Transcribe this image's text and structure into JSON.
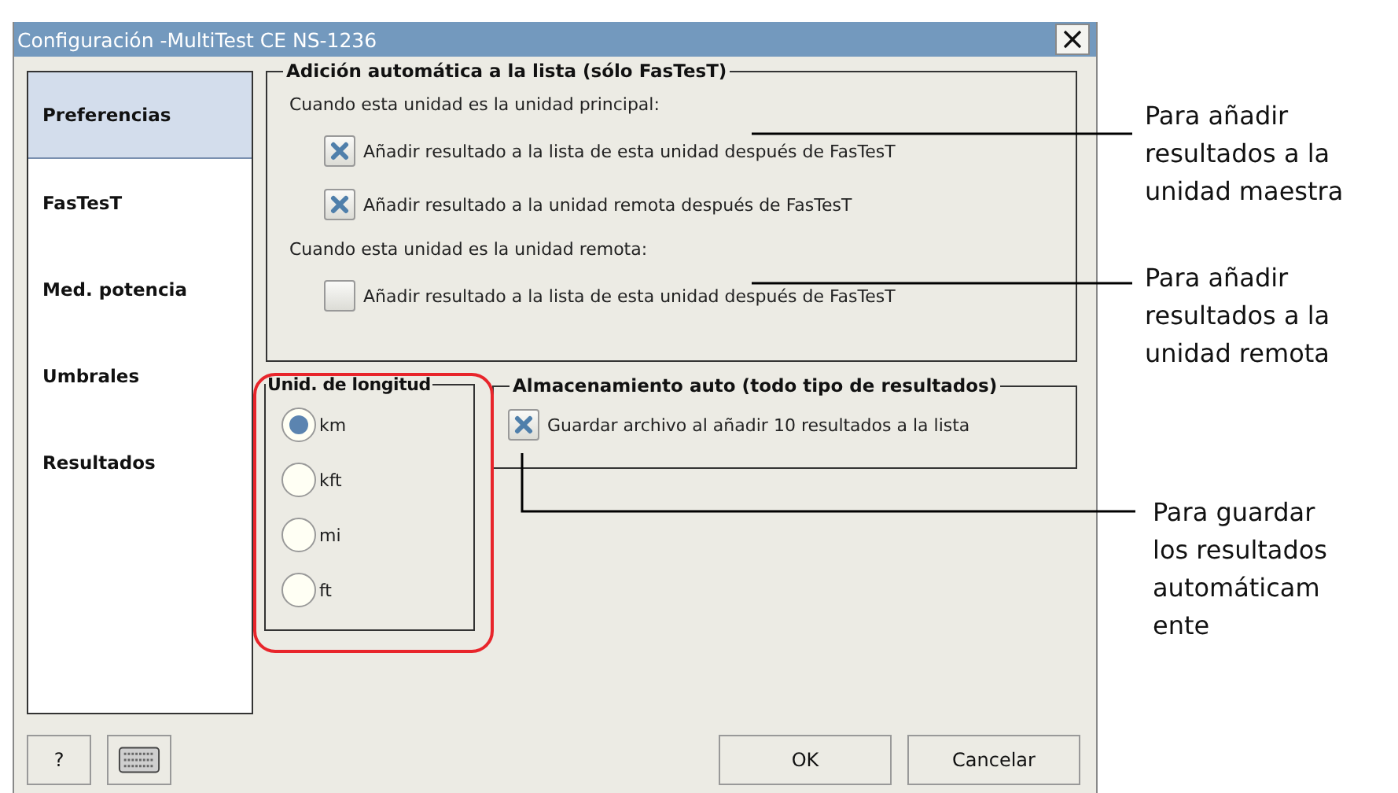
{
  "window": {
    "title": "Configuración -MultiTest CE NS-1236"
  },
  "sidebar": {
    "items": [
      {
        "label": "Preferencias",
        "selected": true
      },
      {
        "label": "FasTesT",
        "selected": false
      },
      {
        "label": "Med. potencia",
        "selected": false
      },
      {
        "label": "Umbrales",
        "selected": false
      },
      {
        "label": "Resultados",
        "selected": false
      }
    ]
  },
  "auto_add": {
    "legend": "Adición automática a la lista (sólo FasTesT)",
    "sections": [
      {
        "heading": "Cuando esta unidad es la unidad principal:",
        "options": [
          {
            "label": "Añadir resultado a la lista de esta unidad después de FasTesT",
            "checked": true
          },
          {
            "label": "Añadir resultado a la unidad remota después de FasTesT",
            "checked": true
          }
        ]
      },
      {
        "heading": "Cuando esta unidad es la unidad remota:",
        "options": [
          {
            "label": "Añadir resultado a la lista de esta unidad después de FasTesT",
            "checked": false
          }
        ]
      }
    ]
  },
  "length_units": {
    "legend": "Unid. de longitud",
    "options": [
      {
        "label": "km",
        "selected": true
      },
      {
        "label": "kft",
        "selected": false
      },
      {
        "label": "mi",
        "selected": false
      },
      {
        "label": "ft",
        "selected": false
      }
    ]
  },
  "auto_save": {
    "legend": "Almacenamiento auto (todo tipo de resultados)",
    "options": [
      {
        "label": "Guardar archivo al añadir 10 resultados a la lista",
        "checked": true
      }
    ]
  },
  "footer": {
    "help_button": "?",
    "buttons": [
      "OK",
      "Cancelar"
    ]
  },
  "callouts": [
    {
      "lines": [
        "Para añadir",
        "resultados a la",
        "unidad maestra"
      ]
    },
    {
      "lines": [
        "Para añadir",
        "resultados a la",
        "unidad remota"
      ]
    },
    {
      "lines": [
        "Para guardar",
        "los resultados",
        "automáticam",
        "ente"
      ]
    }
  ]
}
